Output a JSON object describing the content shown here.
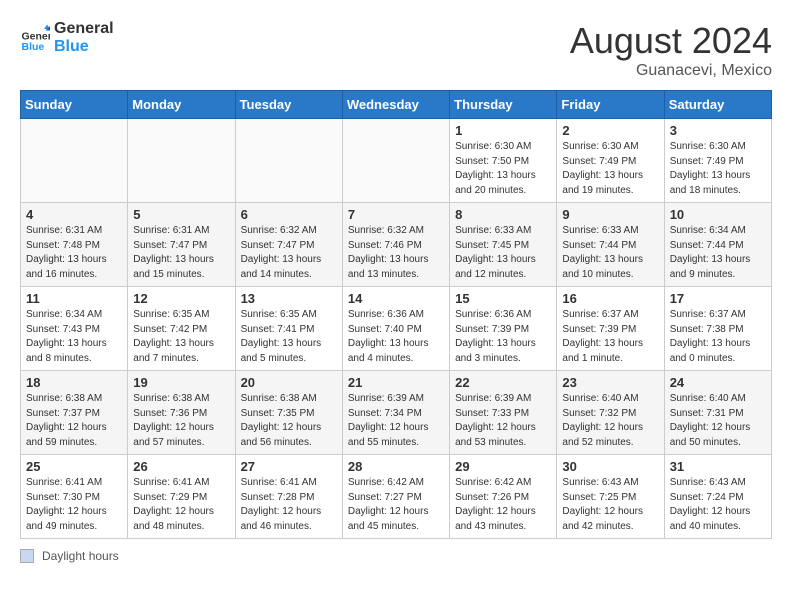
{
  "header": {
    "logo_general": "General",
    "logo_blue": "Blue",
    "month_title": "August 2024",
    "subtitle": "Guanacevi, Mexico"
  },
  "days_of_week": [
    "Sunday",
    "Monday",
    "Tuesday",
    "Wednesday",
    "Thursday",
    "Friday",
    "Saturday"
  ],
  "weeks": [
    [
      {
        "day": "",
        "info": ""
      },
      {
        "day": "",
        "info": ""
      },
      {
        "day": "",
        "info": ""
      },
      {
        "day": "",
        "info": ""
      },
      {
        "day": "1",
        "info": "Sunrise: 6:30 AM\nSunset: 7:50 PM\nDaylight: 13 hours\nand 20 minutes."
      },
      {
        "day": "2",
        "info": "Sunrise: 6:30 AM\nSunset: 7:49 PM\nDaylight: 13 hours\nand 19 minutes."
      },
      {
        "day": "3",
        "info": "Sunrise: 6:30 AM\nSunset: 7:49 PM\nDaylight: 13 hours\nand 18 minutes."
      }
    ],
    [
      {
        "day": "4",
        "info": "Sunrise: 6:31 AM\nSunset: 7:48 PM\nDaylight: 13 hours\nand 16 minutes."
      },
      {
        "day": "5",
        "info": "Sunrise: 6:31 AM\nSunset: 7:47 PM\nDaylight: 13 hours\nand 15 minutes."
      },
      {
        "day": "6",
        "info": "Sunrise: 6:32 AM\nSunset: 7:47 PM\nDaylight: 13 hours\nand 14 minutes."
      },
      {
        "day": "7",
        "info": "Sunrise: 6:32 AM\nSunset: 7:46 PM\nDaylight: 13 hours\nand 13 minutes."
      },
      {
        "day": "8",
        "info": "Sunrise: 6:33 AM\nSunset: 7:45 PM\nDaylight: 13 hours\nand 12 minutes."
      },
      {
        "day": "9",
        "info": "Sunrise: 6:33 AM\nSunset: 7:44 PM\nDaylight: 13 hours\nand 10 minutes."
      },
      {
        "day": "10",
        "info": "Sunrise: 6:34 AM\nSunset: 7:44 PM\nDaylight: 13 hours\nand 9 minutes."
      }
    ],
    [
      {
        "day": "11",
        "info": "Sunrise: 6:34 AM\nSunset: 7:43 PM\nDaylight: 13 hours\nand 8 minutes."
      },
      {
        "day": "12",
        "info": "Sunrise: 6:35 AM\nSunset: 7:42 PM\nDaylight: 13 hours\nand 7 minutes."
      },
      {
        "day": "13",
        "info": "Sunrise: 6:35 AM\nSunset: 7:41 PM\nDaylight: 13 hours\nand 5 minutes."
      },
      {
        "day": "14",
        "info": "Sunrise: 6:36 AM\nSunset: 7:40 PM\nDaylight: 13 hours\nand 4 minutes."
      },
      {
        "day": "15",
        "info": "Sunrise: 6:36 AM\nSunset: 7:39 PM\nDaylight: 13 hours\nand 3 minutes."
      },
      {
        "day": "16",
        "info": "Sunrise: 6:37 AM\nSunset: 7:39 PM\nDaylight: 13 hours\nand 1 minute."
      },
      {
        "day": "17",
        "info": "Sunrise: 6:37 AM\nSunset: 7:38 PM\nDaylight: 13 hours\nand 0 minutes."
      }
    ],
    [
      {
        "day": "18",
        "info": "Sunrise: 6:38 AM\nSunset: 7:37 PM\nDaylight: 12 hours\nand 59 minutes."
      },
      {
        "day": "19",
        "info": "Sunrise: 6:38 AM\nSunset: 7:36 PM\nDaylight: 12 hours\nand 57 minutes."
      },
      {
        "day": "20",
        "info": "Sunrise: 6:38 AM\nSunset: 7:35 PM\nDaylight: 12 hours\nand 56 minutes."
      },
      {
        "day": "21",
        "info": "Sunrise: 6:39 AM\nSunset: 7:34 PM\nDaylight: 12 hours\nand 55 minutes."
      },
      {
        "day": "22",
        "info": "Sunrise: 6:39 AM\nSunset: 7:33 PM\nDaylight: 12 hours\nand 53 minutes."
      },
      {
        "day": "23",
        "info": "Sunrise: 6:40 AM\nSunset: 7:32 PM\nDaylight: 12 hours\nand 52 minutes."
      },
      {
        "day": "24",
        "info": "Sunrise: 6:40 AM\nSunset: 7:31 PM\nDaylight: 12 hours\nand 50 minutes."
      }
    ],
    [
      {
        "day": "25",
        "info": "Sunrise: 6:41 AM\nSunset: 7:30 PM\nDaylight: 12 hours\nand 49 minutes."
      },
      {
        "day": "26",
        "info": "Sunrise: 6:41 AM\nSunset: 7:29 PM\nDaylight: 12 hours\nand 48 minutes."
      },
      {
        "day": "27",
        "info": "Sunrise: 6:41 AM\nSunset: 7:28 PM\nDaylight: 12 hours\nand 46 minutes."
      },
      {
        "day": "28",
        "info": "Sunrise: 6:42 AM\nSunset: 7:27 PM\nDaylight: 12 hours\nand 45 minutes."
      },
      {
        "day": "29",
        "info": "Sunrise: 6:42 AM\nSunset: 7:26 PM\nDaylight: 12 hours\nand 43 minutes."
      },
      {
        "day": "30",
        "info": "Sunrise: 6:43 AM\nSunset: 7:25 PM\nDaylight: 12 hours\nand 42 minutes."
      },
      {
        "day": "31",
        "info": "Sunrise: 6:43 AM\nSunset: 7:24 PM\nDaylight: 12 hours\nand 40 minutes."
      }
    ]
  ],
  "legend": {
    "label": "Daylight hours"
  }
}
